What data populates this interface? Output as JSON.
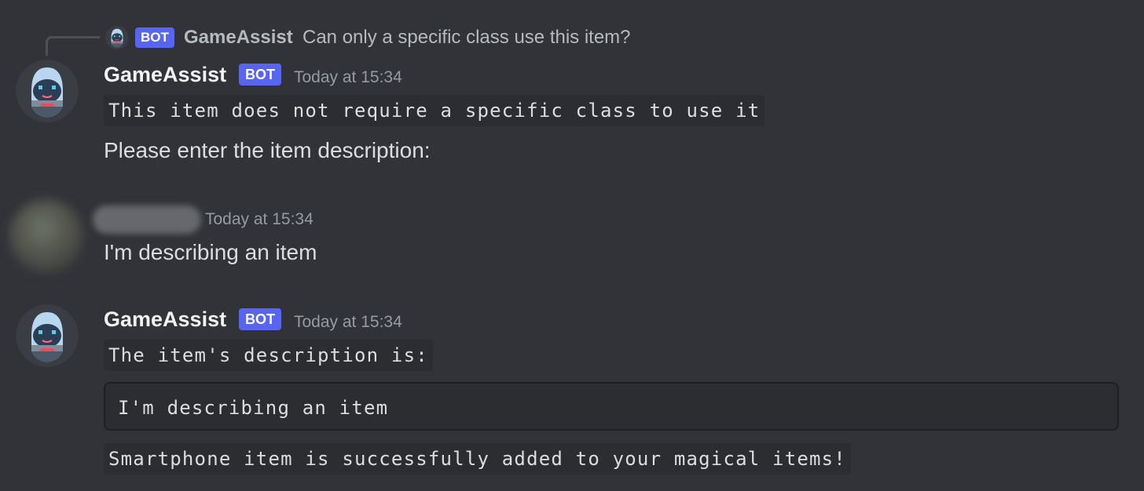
{
  "reply": {
    "badge": "BOT",
    "author": "GameAssist",
    "text": "Can only a specific class use this item?"
  },
  "messages": [
    {
      "author": "GameAssist",
      "badge": "BOT",
      "timestamp": "Today at 15:34",
      "code_line": "This item does not require a specific class to use it",
      "text": "Please enter the item description:"
    },
    {
      "author": "",
      "timestamp": "Today at 15:34",
      "text": "I'm describing an item"
    },
    {
      "author": "GameAssist",
      "badge": "BOT",
      "timestamp": "Today at 15:34",
      "code_line": "The item's description is: ",
      "code_block": "I'm describing an item",
      "code_line_2": "Smartphone item is successfully added to your magical items!"
    }
  ],
  "colors": {
    "background": "#313338",
    "badge": "#5865f2",
    "code_bg": "#2b2d31"
  }
}
